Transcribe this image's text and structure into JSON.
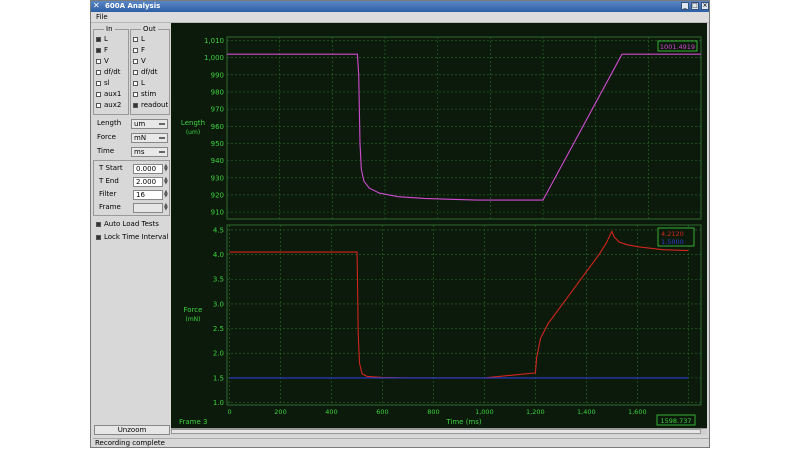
{
  "window": {
    "title": "600A Analysis",
    "buttons": [
      "_",
      "□",
      "×"
    ]
  },
  "menu": {
    "file": "File"
  },
  "io": {
    "in_label": "In",
    "out_label": "Out",
    "in_items": [
      {
        "label": "L",
        "checked": true
      },
      {
        "label": "F",
        "checked": true
      },
      {
        "label": "V",
        "checked": false
      },
      {
        "label": "df/dt",
        "checked": false
      },
      {
        "label": "sl",
        "checked": false
      },
      {
        "label": "aux1",
        "checked": false
      },
      {
        "label": "aux2",
        "checked": false
      }
    ],
    "out_items": [
      {
        "label": "L",
        "checked": false
      },
      {
        "label": "F",
        "checked": false
      },
      {
        "label": "V",
        "checked": false
      },
      {
        "label": "df/dt",
        "checked": false
      },
      {
        "label": "L",
        "checked": false
      },
      {
        "label": "stim",
        "checked": false
      },
      {
        "label": "readout",
        "checked": true
      }
    ]
  },
  "units": {
    "length_label": "Length",
    "length_value": "um",
    "force_label": "Force",
    "force_value": "mN",
    "time_label": "Time",
    "time_value": "ms"
  },
  "params": {
    "tstart_label": "T Start",
    "tstart_value": "0.000",
    "tend_label": "T End",
    "tend_value": "2.000",
    "filter_label": "Filter",
    "filter_value": "16",
    "frame_label": "Frame",
    "frame_value": ""
  },
  "options": {
    "auto_load": {
      "label": "Auto Load Tests",
      "checked": true
    },
    "lock_time": {
      "label": "Lock Time Interval",
      "checked": true
    }
  },
  "unzoom_label": "Unzoom",
  "status_text": "Recording complete",
  "colors": {
    "plot_bg": "#0b1a0b",
    "grid": "#2f6a2f",
    "axis_text": "#3fd23f",
    "length_trace": "#d24ad2",
    "force_trace": "#d2251e",
    "baseline_trace": "#2a3fd0"
  },
  "plot": {
    "frame_label": "Frame 3",
    "cursor_readout": "1598.737",
    "length_readout": "1001.4919",
    "force_readout": "4.2120",
    "force_readout2": "1.5000"
  },
  "chart_data": [
    {
      "type": "line",
      "ylabel": "Length",
      "yunit": "(um)",
      "ylim": [
        906,
        1012
      ],
      "yticks": [
        "1,010",
        "1,000",
        "990",
        "980",
        "970",
        "960",
        "950",
        "940",
        "930",
        "920",
        "910"
      ],
      "xlim": [
        0,
        1800
      ],
      "grid": true,
      "series": [
        {
          "values_x": [
            0,
            495,
            500,
            505,
            510,
            520,
            540,
            580,
            650,
            750,
            850,
            950,
            1050,
            1150,
            1200,
            1500,
            1510,
            1800
          ],
          "values_y": [
            1002,
            1002,
            990,
            950,
            935,
            928,
            924,
            921,
            919,
            918,
            917.5,
            917,
            917,
            917,
            917,
            1002,
            1002,
            1002
          ],
          "color": "#d24ad2"
        }
      ]
    },
    {
      "type": "line",
      "ylabel": "Force",
      "yunit": "(mN)",
      "ylim": [
        0.95,
        4.6
      ],
      "yticks": [
        "4.5",
        "4.0",
        "3.5",
        "3.0",
        "2.5",
        "2.0",
        "1.5",
        "1.0"
      ],
      "xlabel": "Time (ms)",
      "xticks": [
        "0",
        "200",
        "400",
        "600",
        "800",
        "1,000",
        "1,200",
        "1,400",
        "1,600"
      ],
      "xlim": [
        -10,
        1850
      ],
      "grid": true,
      "series": [
        {
          "values_x": [
            0,
            500,
            502,
            505,
            510,
            520,
            540,
            600,
            700,
            800,
            900,
            1000,
            1100,
            1200,
            1205,
            1220,
            1250,
            1300,
            1350,
            1400,
            1450,
            1480,
            1500,
            1510,
            1530,
            1560,
            1600,
            1650,
            1700,
            1800
          ],
          "values_y": [
            4.05,
            4.05,
            3.5,
            2.4,
            1.8,
            1.58,
            1.53,
            1.51,
            1.5,
            1.5,
            1.5,
            1.5,
            1.55,
            1.6,
            1.9,
            2.3,
            2.6,
            2.95,
            3.3,
            3.65,
            4.0,
            4.25,
            4.47,
            4.35,
            4.25,
            4.2,
            4.16,
            4.13,
            4.1,
            4.08
          ],
          "color": "#d2251e"
        },
        {
          "values_x": [
            0,
            1800
          ],
          "values_y": [
            1.5,
            1.5
          ],
          "color": "#2a3fd0"
        }
      ]
    }
  ]
}
